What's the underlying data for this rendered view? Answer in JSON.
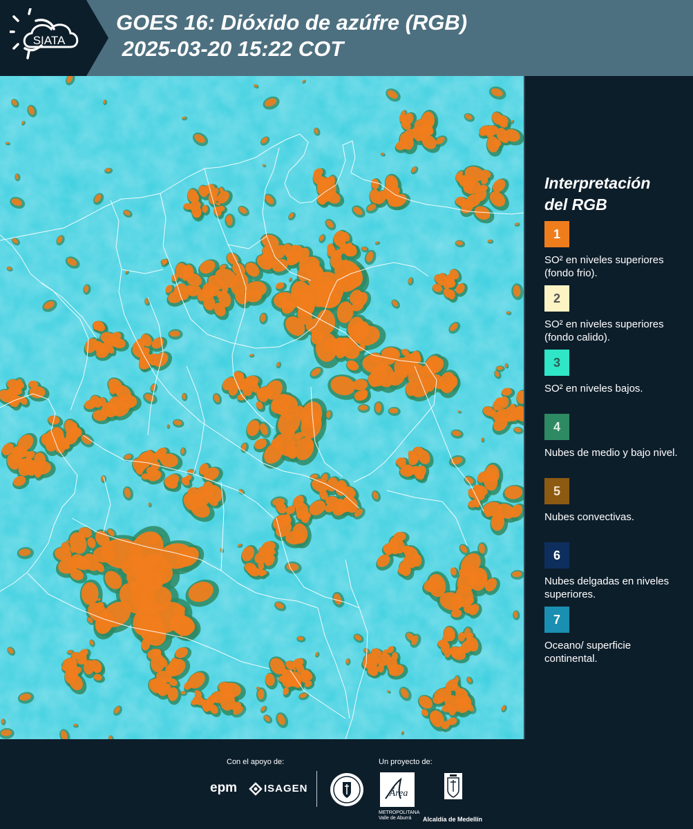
{
  "header": {
    "logo_text": "SIATA",
    "title": "GOES 16: Dióxido de azúfre (RGB)\n 2025-03-20 15:22 COT"
  },
  "legend": {
    "title": "Interpretación\ndel RGB",
    "items": [
      {
        "num": "1",
        "color": "#f07d1c",
        "num_color": "#ffffff",
        "text": "SO² en niveles superiores (fondo frio)."
      },
      {
        "num": "2",
        "color": "#fdf4c4",
        "num_color": "#555555",
        "text": "SO² en niveles superiores (fondo calido)."
      },
      {
        "num": "3",
        "color": "#2fe6c7",
        "num_color": "#2a5f55",
        "text": "SO² en niveles bajos."
      },
      {
        "num": "4",
        "color": "#2e8a63",
        "num_color": "#e0efe7",
        "text": "Nubes de medio y bajo nivel."
      },
      {
        "num": "5",
        "color": "#8d5a12",
        "num_color": "#f5e6cf",
        "text": "Nubes convectivas."
      },
      {
        "num": "6",
        "color": "#0e2f5d",
        "num_color": "#ffffff",
        "text": "Nubes delgadas en niveles superiores."
      },
      {
        "num": "7",
        "color": "#1a8fb1",
        "num_color": "#ffffff",
        "text": "Oceano/ superficie continental."
      }
    ]
  },
  "map": {
    "background_color": "#3ed0e0",
    "cloud_color": "#f07d1c",
    "fringe_color": "#2e8a63",
    "border_color": "#ffffff"
  },
  "footer": {
    "support_label": "Con el apoyo de:",
    "project_label": "Un proyecto de:",
    "epm": "epm",
    "isagen": "ISAGEN",
    "area_name": "Área",
    "area_sub": "METROPOLITANA\nValle de Aburrá",
    "alcaldia": "Alcaldía de Medellín"
  }
}
